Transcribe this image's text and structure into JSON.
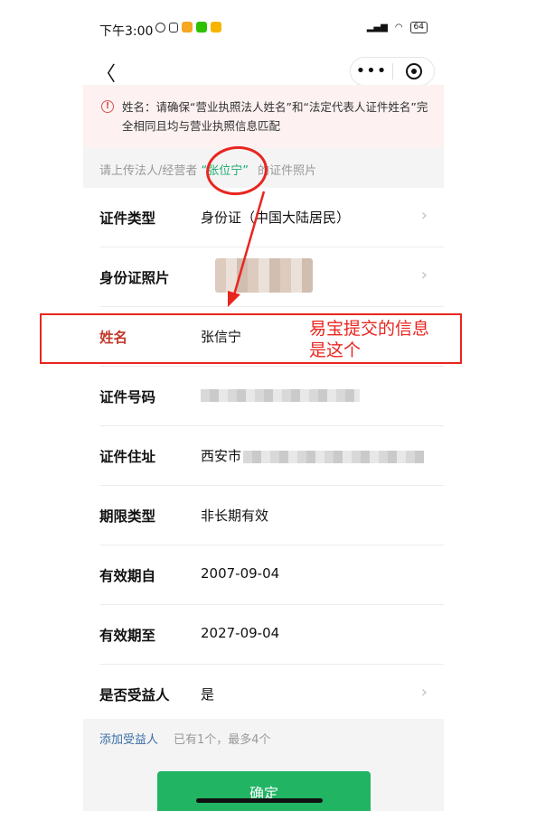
{
  "status_bar": {
    "time": "下午3:00",
    "battery": "64"
  },
  "nav": {
    "more_label": "•••"
  },
  "warning": {
    "text": "姓名：请确保“营业执照法人姓名”和“法定代表人证件姓名”完全相同且均与营业执照信息匹配"
  },
  "upload_hint": {
    "prefix": "请上传法人/经营者",
    "name": "“张位宁”",
    "suffix": "的证件照片"
  },
  "rows": [
    {
      "label": "证件类型",
      "value": "身份证（中国大陆居民）",
      "chevron": true
    },
    {
      "label": "身份证照片",
      "value": "",
      "chevron": true
    },
    {
      "label": "姓名",
      "value": "张信宁",
      "chevron": false
    },
    {
      "label": "证件号码",
      "value": "",
      "chevron": false
    },
    {
      "label": "证件住址",
      "value": "西安市",
      "chevron": false
    },
    {
      "label": "期限类型",
      "value": "非长期有效",
      "chevron": false
    },
    {
      "label": "有效期自",
      "value": "2007-09-04",
      "chevron": false
    },
    {
      "label": "有效期至",
      "value": "2027-09-04",
      "chevron": false
    },
    {
      "label": "是否受益人",
      "value": "是",
      "chevron": true
    }
  ],
  "beneficiary": {
    "add_label": "添加受益人",
    "count_text": "已有1个，最多4个"
  },
  "confirm": {
    "label": "确定"
  },
  "annotation": {
    "note": "易宝提交的信息是这个"
  },
  "colors": {
    "accent_green": "#21b463",
    "annotation_red": "#e8261f",
    "link_blue": "#3a6ea5"
  }
}
